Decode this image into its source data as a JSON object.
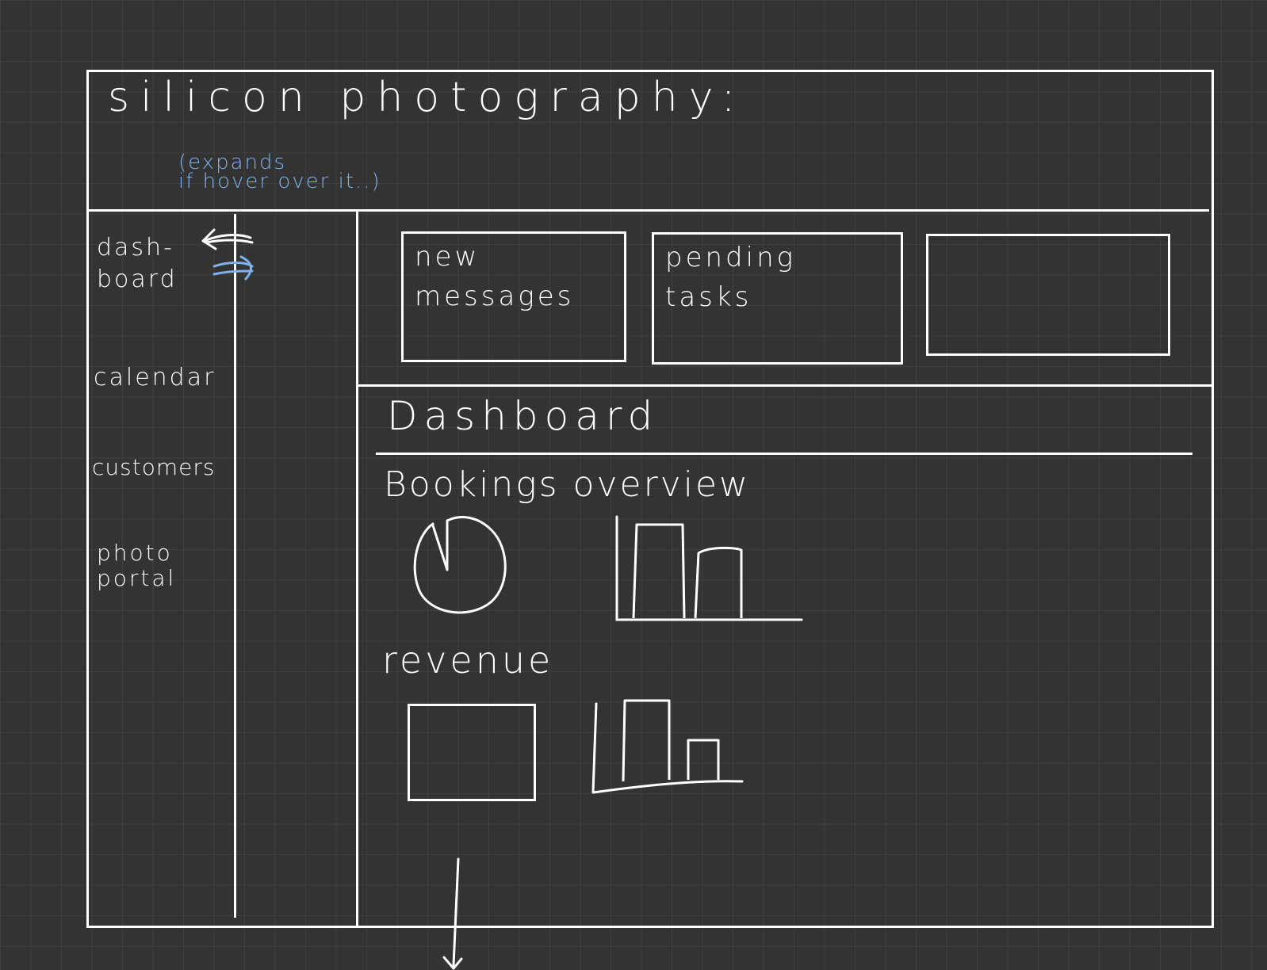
{
  "header": {
    "app_title": "silicon photography:",
    "hover_note": "(expands\nif hover over it..)"
  },
  "sidebar": {
    "items": [
      {
        "label": "dash-\nboard"
      },
      {
        "label": "calendar"
      },
      {
        "label": "customers"
      },
      {
        "label": "photo\nportal"
      }
    ],
    "arrow_colors": {
      "expand": "#ffffff",
      "collapse": "#7eb2ec"
    }
  },
  "cards": [
    {
      "label": "new\nmessages"
    },
    {
      "label": "pending\ntasks"
    },
    {
      "label": ""
    }
  ],
  "main": {
    "page_title": "Dashboard",
    "sections": [
      {
        "label": "Bookings  overview"
      },
      {
        "label": "revenue"
      }
    ]
  },
  "colors": {
    "background": "#333333",
    "grid": "#3f3f3f",
    "ink": "#ffffff",
    "annotation": "#7eb2ec"
  },
  "icons": [
    "expand-arrow-icon",
    "collapse-arrow-icon",
    "scroll-down-arrow-icon"
  ]
}
